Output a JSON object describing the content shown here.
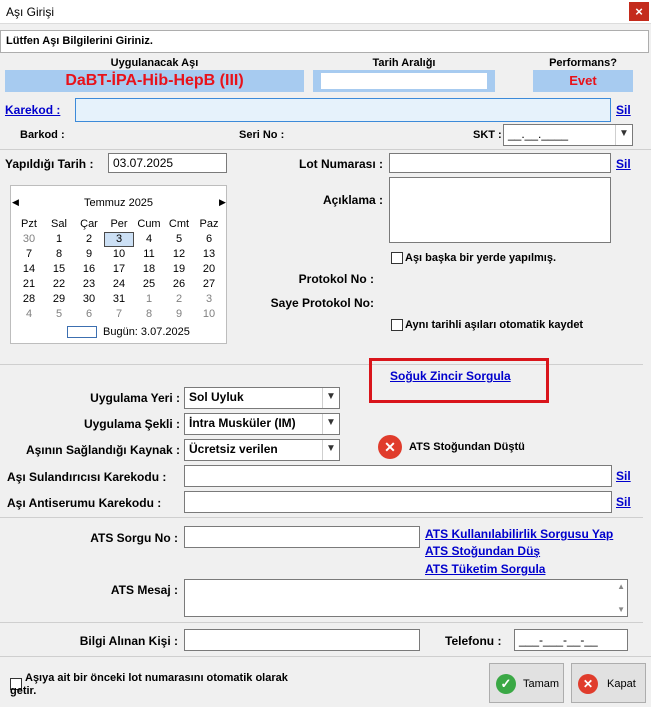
{
  "window": {
    "title": "Aşı Girişi",
    "close_glyph": "×"
  },
  "prompt": "Lütfen Aşı Bilgilerini Giriniz.",
  "header": {
    "vaccine_label": "Uygulanacak Aşı",
    "vaccine_value": "DaBT-İPA-Hib-HepB (III)",
    "date_range_label": "Tarih Aralığı",
    "date_range_value": "",
    "performance_label": "Performans?",
    "performance_value": "Evet"
  },
  "karekod": {
    "label": "Karekod :",
    "value": "",
    "clear": "Sil"
  },
  "barcode_row": {
    "barkod_label": "Barkod :",
    "seri_label": "Seri No :",
    "skt_label": "SKT :",
    "skt_value": "__.__.____"
  },
  "date": {
    "label": "Yapıldığı Tarih :",
    "value": "03.07.2025"
  },
  "calendar": {
    "month": "Temmuz 2025",
    "days": [
      "Pzt",
      "Sal",
      "Çar",
      "Per",
      "Cum",
      "Cmt",
      "Paz"
    ],
    "weeks": [
      [
        "30",
        "1",
        "2",
        "3",
        "4",
        "5",
        "6"
      ],
      [
        "7",
        "8",
        "9",
        "10",
        "11",
        "12",
        "13"
      ],
      [
        "14",
        "15",
        "16",
        "17",
        "18",
        "19",
        "20"
      ],
      [
        "21",
        "22",
        "23",
        "24",
        "25",
        "26",
        "27"
      ],
      [
        "28",
        "29",
        "30",
        "31",
        "1",
        "2",
        "3"
      ],
      [
        "4",
        "5",
        "6",
        "7",
        "8",
        "9",
        "10"
      ]
    ],
    "today_label": "Bugün: 3.07.2025"
  },
  "lot": {
    "label": "Lot Numarası :",
    "value": "",
    "clear": "Sil"
  },
  "description": {
    "label": "Açıklama :",
    "value": ""
  },
  "elsewhere_checkbox": "Aşı başka bir yerde yapılmış.",
  "protocol_label": "Protokol No :",
  "saye_protocol_label": "Saye Protokol No:",
  "auto_save_checkbox": "Aynı tarihli aşıları otomatik kaydet",
  "cold_chain_link": "Soğuk Zincir Sorgula",
  "application": {
    "site_label": "Uygulama Yeri :",
    "site_value": "Sol Uyluk",
    "method_label": "Uygulama Şekli :",
    "method_value": "İntra Musküler (IM)",
    "source_label": "Aşının Sağlandığı Kaynak :",
    "source_value": "Ücretsiz verilen"
  },
  "ats_status": "ATS Stoğundan Düştü",
  "diluent": {
    "label": "Aşı Sulandırıcısı Karekodu :",
    "value": "",
    "clear": "Sil"
  },
  "antiserum": {
    "label": "Aşı Antiserumu Karekodu :",
    "value": "",
    "clear": "Sil"
  },
  "ats": {
    "query_label": "ATS Sorgu No :",
    "query_value": "",
    "usability_link": "ATS Kullanılabilirlik Sorgusu Yap",
    "deduct_link": "ATS Stoğundan Düş",
    "consumption_link": "ATS Tüketim Sorgula",
    "message_label": "ATS Mesaj :",
    "message_value": ""
  },
  "informant": {
    "label": "Bilgi Alınan Kişi :",
    "value": ""
  },
  "phone": {
    "label": "Telefonu :",
    "value": "___-___-__-__"
  },
  "footer": {
    "auto_lot_checkbox": "Aşıya ait bir önceki lot numarasını otomatik olarak getir.",
    "ok_button": "Tamam",
    "close_button": "Kapat"
  },
  "colors": {
    "header_panel": "#a7cbf0",
    "vaccine_text": "#e8121a",
    "link": "#0000cc",
    "highlight_box": "#d9151b"
  }
}
